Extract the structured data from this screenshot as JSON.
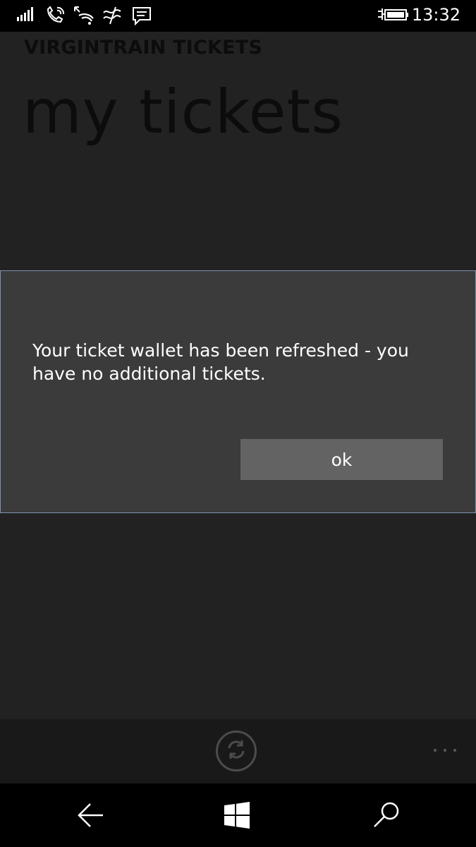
{
  "status_bar": {
    "time": "13:32",
    "icons": [
      "signal-bars-icon",
      "wifi-calling-icon",
      "wifi-icon",
      "data-sense-icon",
      "message-icon",
      "battery-charging-icon"
    ]
  },
  "app": {
    "title": "VIRGINTRAIN TICKETS",
    "page_title": "my tickets"
  },
  "dialog": {
    "message": "Your ticket wallet has been refreshed - you have no additional tickets.",
    "ok_label": "ok"
  },
  "app_bar": {
    "buttons": [
      "refresh-icon",
      "more-icon"
    ]
  },
  "nav_bar": {
    "buttons": [
      "back-arrow-icon",
      "windows-start-icon",
      "search-icon"
    ]
  },
  "colors": {
    "background": "#222222",
    "dialog_bg": "#3b3b3b",
    "dialog_border": "#7d93ad",
    "button_bg": "#636363"
  }
}
